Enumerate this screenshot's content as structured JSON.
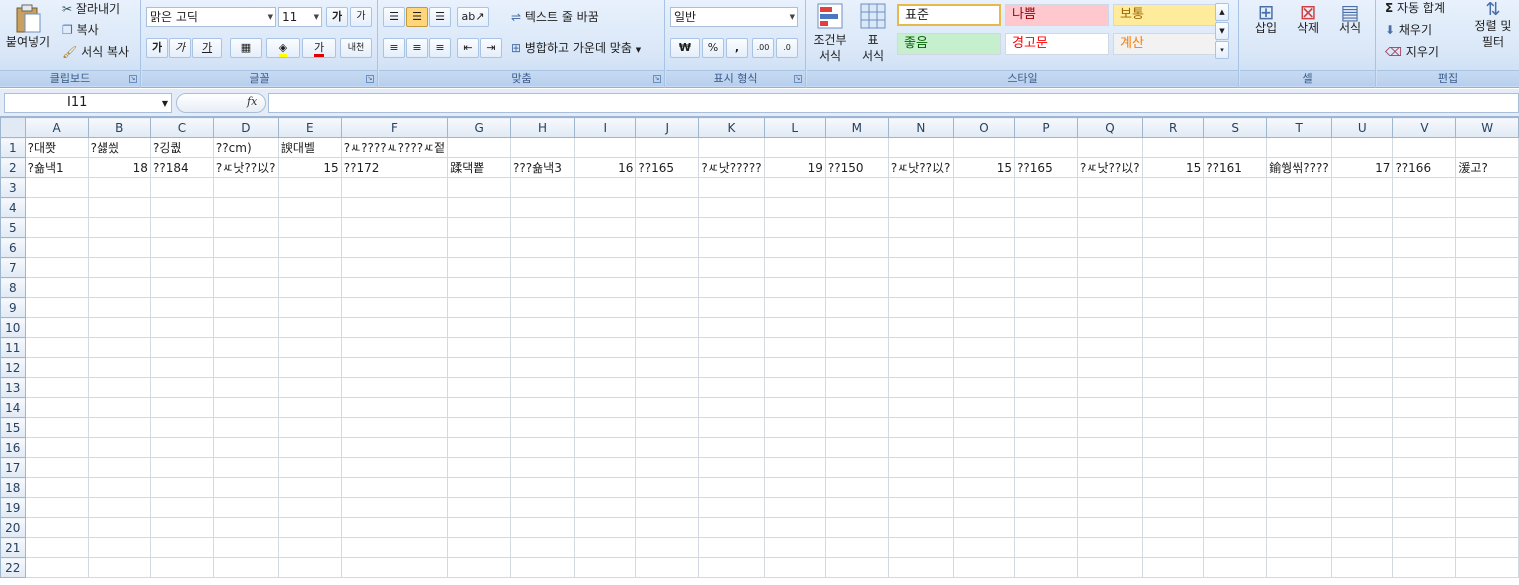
{
  "ribbon": {
    "clipboard": {
      "paste_label": "붙여넣기",
      "cut_label": "잘라내기",
      "copy_label": "복사",
      "format_painter_label": "서식 복사",
      "group_label": "클립보드"
    },
    "font": {
      "font_name": "맑은 고딕",
      "font_size": "11",
      "bold": "가",
      "italic": "가",
      "underline": "가",
      "grow_font": "가",
      "group_label": "글꼴"
    },
    "alignment": {
      "wrap_text_label": "텍스트 줄 바꿈",
      "merge_label": "병합하고 가운데 맞춤",
      "group_label": "맞춤"
    },
    "number": {
      "format_value": "일반",
      "currency": "₩",
      "percent": "%",
      "comma": ",",
      "group_label": "표시 형식"
    },
    "styles": {
      "conditional_label_1": "조건부",
      "conditional_label_2": "서식",
      "table_label_1": "표",
      "table_label_2": "서식",
      "cells": [
        {
          "label": "표준",
          "bg": "#ffffff",
          "color": "#1e1e1e"
        },
        {
          "label": "나쁨",
          "bg": "#ffc7ce",
          "color": "#9c0006"
        },
        {
          "label": "보통",
          "bg": "#ffeb9c",
          "color": "#9c6500"
        },
        {
          "label": "좋음",
          "bg": "#c6efce",
          "color": "#006100"
        },
        {
          "label": "경고문",
          "bg": "#ffffff",
          "color": "#ff0000"
        },
        {
          "label": "계산",
          "bg": "#f2f2f2",
          "color": "#fa7d00"
        }
      ],
      "group_label": "스타일"
    },
    "cells_group": {
      "insert_label": "삽입",
      "delete_label": "삭제",
      "format_label": "서식",
      "group_label": "셀"
    },
    "editing": {
      "autosum_label": "자동 합계",
      "fill_label": "채우기",
      "clear_label": "지우기",
      "sort_label_1": "정렬 및",
      "sort_label_2": "필터",
      "group_label": "편집"
    }
  },
  "formula_bar": {
    "name_box": "I11",
    "fx": "fx",
    "formula": ""
  },
  "sheet": {
    "columns": [
      "A",
      "B",
      "C",
      "D",
      "E",
      "F",
      "G",
      "H",
      "I",
      "J",
      "K",
      "L",
      "M",
      "N",
      "O",
      "P",
      "Q",
      "R",
      "S",
      "T",
      "U",
      "V",
      "W"
    ],
    "rows": [
      [
        "?대쫫",
        "?섏씠",
        "?깅퀎",
        "??cm)",
        "諛대벨",
        "?ㅻ????ㅻ????ㅼ젙",
        "",
        "",
        "",
        "",
        "",
        "",
        "",
        "",
        "",
        "",
        "",
        "",
        "",
        "",
        "",
        "",
        ""
      ],
      [
        "?숆낵1",
        "18",
        "??184",
        "?ㅼ낫??以?",
        "15",
        "??172",
        "蹂댁뿉",
        "???숆낵3",
        "16",
        "??165",
        "?ㅼ낫?????",
        "19",
        "??150",
        "?ㅼ낫??以?",
        "15",
        "??165",
        "?ㅼ낫??以?",
        "15",
        "??161",
        "鍮쒕씪????",
        "17",
        "??166",
        "湲고?"
      ]
    ],
    "row_count": 22
  }
}
